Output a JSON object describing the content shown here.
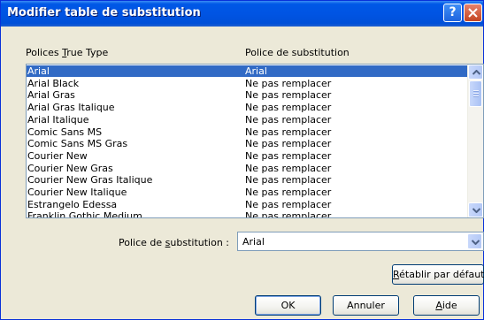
{
  "dialog": {
    "title": "Modifier table de substitution",
    "header_col1_pre": "Polices ",
    "header_col1_ul": "T",
    "header_col1_post": "rue Type",
    "header_col2": "Police de substitution",
    "fonts": [
      {
        "name": "Arial",
        "substitute": "Arial",
        "selected": true
      },
      {
        "name": "Arial Black",
        "substitute": "Ne pas remplacer"
      },
      {
        "name": "Arial Gras",
        "substitute": "Ne pas remplacer"
      },
      {
        "name": "Arial Gras Italique",
        "substitute": "Ne pas remplacer"
      },
      {
        "name": "Arial Italique",
        "substitute": "Ne pas remplacer"
      },
      {
        "name": "Comic Sans MS",
        "substitute": "Ne pas remplacer"
      },
      {
        "name": "Comic Sans MS Gras",
        "substitute": "Ne pas remplacer"
      },
      {
        "name": "Courier New",
        "substitute": "Ne pas remplacer"
      },
      {
        "name": "Courier New Gras",
        "substitute": "Ne pas remplacer"
      },
      {
        "name": "Courier New Gras Italique",
        "substitute": "Ne pas remplacer"
      },
      {
        "name": "Courier New Italique",
        "substitute": "Ne pas remplacer"
      },
      {
        "name": "Estrangelo Edessa",
        "substitute": "Ne pas remplacer"
      },
      {
        "name": "Franklin Gothic Medium",
        "substitute": "Ne pas remplacer"
      }
    ],
    "substitution_label_pre": "Police de ",
    "substitution_label_ul": "s",
    "substitution_label_post": "ubstitution :",
    "substitution_value": "Arial",
    "reset_ul": "R",
    "reset_rest": "établir par défaut",
    "ok_label": "OK",
    "cancel_label": "Annuler",
    "help_ul": "A",
    "help_rest": "ide",
    "titlebar_help_glyph": "?",
    "icons": [
      "help-icon",
      "close-icon",
      "scroll-up-icon",
      "scroll-down-icon",
      "dropdown-arrow-icon"
    ]
  }
}
